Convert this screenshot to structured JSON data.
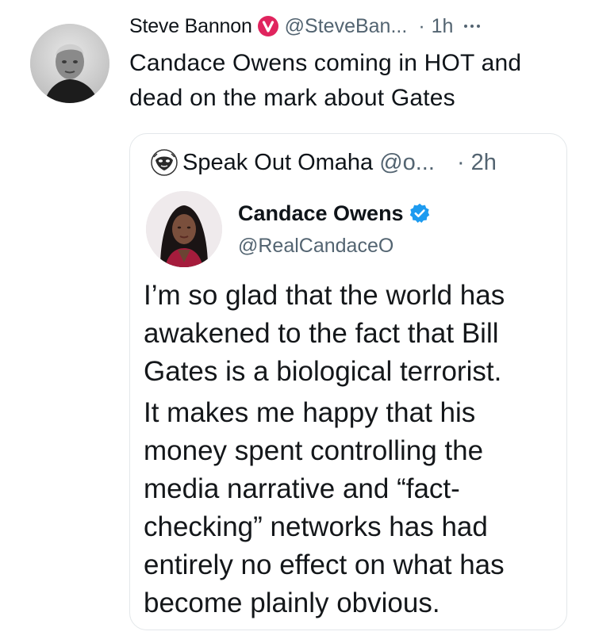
{
  "tweet": {
    "author_name": "Steve Bannon",
    "author_handle": "@SteveBan...",
    "separator": "·",
    "time": "1h",
    "more_label": "···",
    "text": "Candace Owens coming in HOT and dead on the mark about Gates",
    "verified_badge_color": "#e0245e"
  },
  "quote": {
    "author_name": "Speak Out Omaha",
    "author_handle": "@o...",
    "separator": "·",
    "time": "2h",
    "embedded": {
      "author_name": "Candace Owens",
      "author_handle": "@RealCandaceO",
      "verified_badge_color": "#1d9bf0",
      "paragraphs": [
        "I’m so glad that the world has awakened to the fact that Bill Gates is a biological terrorist.",
        "It makes me happy that his money spent controlling the media narrative and “fact-checking” networks has had entirely no effect on what has become plainly obvious."
      ]
    }
  },
  "icons": {
    "outer_verified": "verified-red-icon",
    "inner_verified": "verified-blue-icon",
    "more": "more-dots-icon"
  }
}
